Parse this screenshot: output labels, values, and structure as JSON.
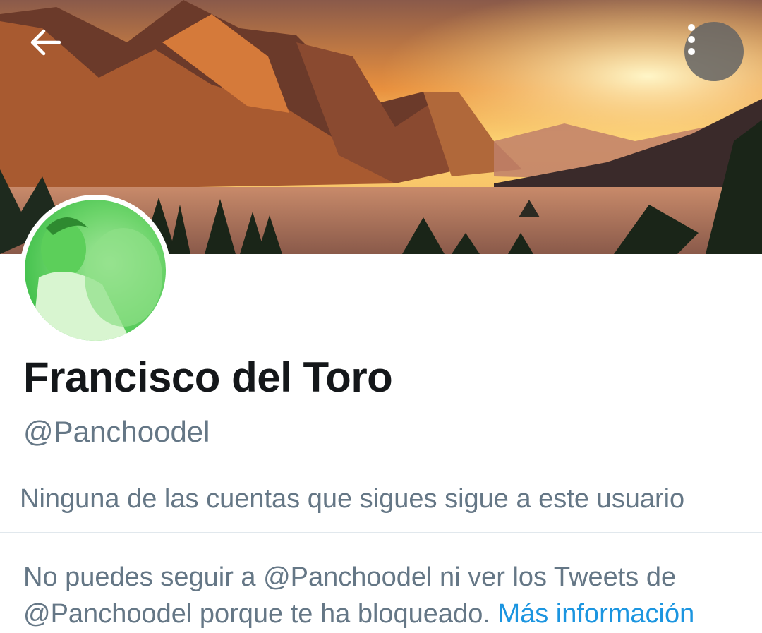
{
  "header": {
    "back_icon": "arrow-left-icon",
    "more_icon": "more-vertical-icon",
    "banner_image": "mountain-lake-sunset"
  },
  "profile": {
    "display_name": "Francisco del Toro",
    "handle": "@Panchoodel",
    "avatar_image": "person-photo-green-tint",
    "followers_note": "Ninguna de las cuentas que sigues sigue a este usuario"
  },
  "blocked": {
    "message": "No puedes seguir a @Panchoodel ni ver los Tweets de @Panchoodel porque te ha bloqueado.",
    "link_label": "Más información"
  },
  "colors": {
    "name": "#14171a",
    "secondary_text": "#657786",
    "link": "#1b95e0",
    "divider": "#e1e8ed"
  }
}
